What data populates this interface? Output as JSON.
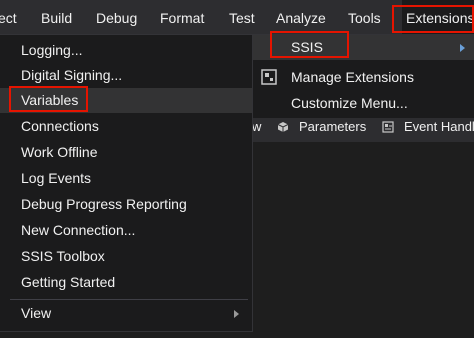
{
  "menubar": {
    "items": [
      {
        "label": "ect"
      },
      {
        "label": "Build"
      },
      {
        "label": "Debug"
      },
      {
        "label": "Format"
      },
      {
        "label": "Test"
      },
      {
        "label": "Analyze"
      },
      {
        "label": "Tools"
      },
      {
        "label": "Extensions"
      }
    ]
  },
  "toolbar": {
    "parameters_label": "Parameters",
    "event_handlers_label": "Event Handl",
    "partial_label": "w"
  },
  "ssis_menu": {
    "items": [
      {
        "label": "Logging..."
      },
      {
        "label": "Digital Signing..."
      },
      {
        "label": "Variables"
      },
      {
        "label": "Connections"
      },
      {
        "label": "Work Offline"
      },
      {
        "label": "Log Events"
      },
      {
        "label": "Debug Progress Reporting"
      },
      {
        "label": "New Connection..."
      },
      {
        "label": "SSIS Toolbox"
      },
      {
        "label": "Getting Started"
      },
      {
        "label": "View"
      }
    ]
  },
  "extensions_menu": {
    "items": [
      {
        "label": "SSIS"
      },
      {
        "label": "Manage Extensions"
      },
      {
        "label": "Customize Menu..."
      }
    ]
  },
  "colors": {
    "annotation_red": "#e51400",
    "menu_bg": "#1b1b1c",
    "menubar_bg": "#2d2d30",
    "hover_bg": "#333334"
  }
}
